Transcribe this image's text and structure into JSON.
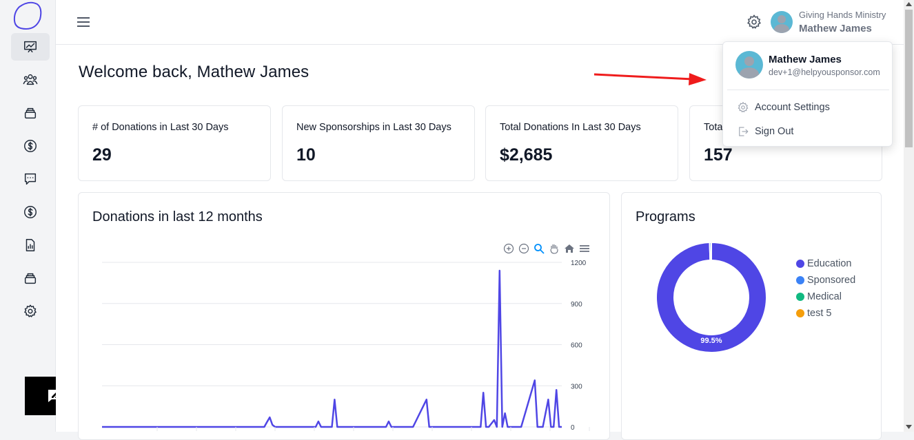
{
  "header": {
    "org_name": "Giving Hands Ministry",
    "user_name": "Mathew James"
  },
  "welcome": "Welcome back, Mathew James",
  "stats": [
    {
      "label": "# of Donations in Last 30 Days",
      "value": "29"
    },
    {
      "label": "New Sponsorships in Last 30 Days",
      "value": "10"
    },
    {
      "label": "Total Donations In Last 30 Days",
      "value": "$2,685"
    },
    {
      "label": "Tota",
      "value": "157"
    }
  ],
  "donations_panel": {
    "title": "Donations in last 12 months"
  },
  "programs_panel": {
    "title": "Programs"
  },
  "dropdown": {
    "name": "Mathew James",
    "email": "dev+1@helpyousponsor.com",
    "account_settings": "Account Settings",
    "sign_out": "Sign Out"
  },
  "colors": {
    "accent": "#4f46e5",
    "avatar": "#5bb8d4"
  },
  "chart_data": [
    {
      "type": "line",
      "title": "Donations in last 12 months",
      "ylim": [
        0,
        1200
      ],
      "yticks": [
        "1200",
        "900",
        "600",
        "300",
        "0"
      ],
      "y_axis_position": "right",
      "grid": true,
      "series": [
        {
          "x": [
            0,
            10,
            20,
            30,
            40,
            50,
            60,
            61,
            62,
            63,
            64,
            65,
            70,
            79,
            80,
            81,
            85,
            86,
            87,
            90,
            100,
            105,
            106,
            107,
            108,
            115,
            120,
            121,
            122,
            123,
            130,
            140,
            141,
            142,
            143,
            145,
            146,
            147,
            148,
            149,
            150,
            151,
            152,
            153,
            155,
            160,
            161,
            162,
            163,
            165,
            166,
            167,
            168,
            169,
            170
          ],
          "values": [
            0,
            0,
            0,
            0,
            0,
            0,
            0,
            35,
            70,
            15,
            0,
            0,
            0,
            0,
            40,
            0,
            0,
            200,
            0,
            0,
            0,
            0,
            40,
            0,
            0,
            0,
            200,
            0,
            0,
            0,
            0,
            0,
            250,
            0,
            0,
            50,
            0,
            1140,
            0,
            100,
            0,
            0,
            0,
            0,
            0,
            340,
            0,
            0,
            0,
            200,
            0,
            0,
            270,
            0,
            0
          ]
        }
      ]
    },
    {
      "type": "pie",
      "title": "Programs",
      "legend": "right",
      "categories": [
        "Education",
        "Sponsored",
        "Medical",
        "test 5"
      ],
      "values": [
        99.5,
        0.5,
        0,
        0
      ],
      "colors": [
        "#4f46e5",
        "#3b82f6",
        "#10b981",
        "#f59e0b"
      ],
      "data_labels": [
        "99.5%"
      ]
    }
  ]
}
